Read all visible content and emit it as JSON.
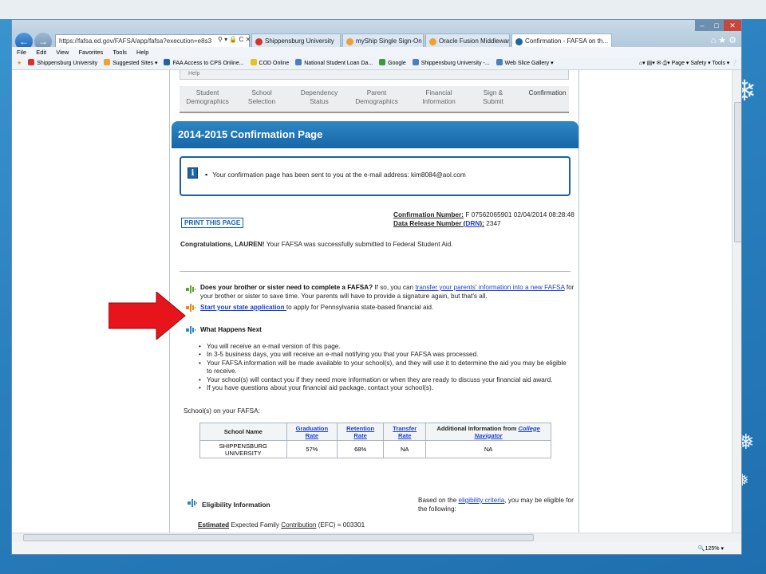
{
  "browser": {
    "address": "https://fafsa.ed.gov/FAFSA/app/fafsa?execution=e8s3",
    "address_domain": "fafsa.ed.gov",
    "tabs": [
      {
        "label": "Shippensburg University",
        "color": "#d4332b"
      },
      {
        "label": "myShip Single Sign-On",
        "color": "#f0a030"
      },
      {
        "label": "Oracle Fusion Middleware For...",
        "color": "#f0a030"
      },
      {
        "label": "Confirmation - FAFSA on th...",
        "color": "#1d63a6"
      }
    ],
    "menu": [
      "File",
      "Edit",
      "View",
      "Favorites",
      "Tools",
      "Help"
    ],
    "favorites": [
      {
        "label": "Shippensburg University",
        "color": "#d4332b"
      },
      {
        "label": "Suggested Sites ▾",
        "color": "#f0a030"
      },
      {
        "label": "FAA Access to CPS Online...",
        "color": "#1d63a6"
      },
      {
        "label": "COD Online",
        "color": "#e8c020"
      },
      {
        "label": "National Student Loan Da...",
        "color": "#4a7fc0"
      },
      {
        "label": "Google",
        "color": "#3d9a3d"
      },
      {
        "label": "Shippensburg University -...",
        "color": "#4a7fc0"
      },
      {
        "label": "Web Slice Gallery ▾",
        "color": "#4a7fc0"
      }
    ],
    "command_items": [
      "Page ▾",
      "Safety ▾",
      "Tools ▾"
    ],
    "zoom": "125%"
  },
  "page": {
    "help_label": "Help",
    "steps": [
      {
        "line1": "Student",
        "line2": "Demographics"
      },
      {
        "line1": "School",
        "line2": "Selection"
      },
      {
        "line1": "Dependency",
        "line2": "Status"
      },
      {
        "line1": "Parent",
        "line2": "Demographics"
      },
      {
        "line1": "Financial",
        "line2": "Information"
      },
      {
        "line1": "Sign &",
        "line2": "Submit"
      },
      {
        "line1": "Confirmation",
        "line2": ""
      }
    ],
    "title": "2014-2015 Confirmation Page",
    "notice": "Your confirmation page has been sent to you at the e-mail address: kim8084@aol.com",
    "print_button": "PRINT THIS PAGE",
    "confirmation_number_label": "Confirmation Number:",
    "confirmation_number_value": " F 07562065901 02/04/2014 08:28:48",
    "drn_label_prefix": "Data Release Number (",
    "drn_link": "DRN",
    "drn_label_suffix": "):",
    "drn_value": " 2347",
    "congrats_bold": "Congratulations, LAUREN!",
    "congrats_rest": " Your FAFSA was successfully submitted to Federal Student Aid.",
    "sibling_bold": "Does your brother or sister need to complete a FAFSA?",
    "sibling_pre": " If so, you can ",
    "sibling_link": "transfer your parents' information into a new FAFSA",
    "sibling_post": " for",
    "sibling_line2": "your brother or sister to save time. Your parents will have to provide a signature again, but that's all.",
    "state_link": "Start your state application ",
    "state_rest": "to apply for Pennsylvania state-based financial aid.",
    "next_title": "What Happens Next",
    "next_items": [
      "You will receive an e-mail version of this page.",
      "In 3-5 business days, you will receive an e-mail notifying you that your FAFSA was processed.",
      "Your FAFSA information will be made available to your school(s), and they will use it to determine the aid you may be eligible to receive.",
      "Your school(s) will contact you if they need more information or when they are ready to discuss your financial aid award.",
      "If you have questions about your financial aid package, contact your school(s)."
    ],
    "schools_label": "School(s) on your FAFSA:",
    "table_headers": {
      "school_name": "School Name",
      "graduation_rate": "Graduation Rate",
      "retention_rate": "Retention Rate",
      "transfer_rate": "Transfer Rate",
      "additional_prefix": "Additional Information from ",
      "additional_link": "College Navigator"
    },
    "school_row": {
      "name": "SHIPPENSBURG UNIVERSITY",
      "graduation_rate": "57%",
      "retention_rate": "68%",
      "transfer_rate": "NA",
      "additional": "NA"
    },
    "eligibility_title": "Eligibility Information",
    "eligibility_pre": "Based on the ",
    "eligibility_link": "eligibility criteria",
    "eligibility_post": ", you may be eligible for the following:",
    "efc_underlined": "Estimated",
    "efc_middle": " Expected Family ",
    "efc_contribution": "Contribution",
    "efc_rest": " (EFC) = 003301"
  },
  "colors": {
    "fafsa_blue": "#1666a8",
    "link_blue": "#1a3fd0",
    "arrow_red": "#e8141c"
  }
}
